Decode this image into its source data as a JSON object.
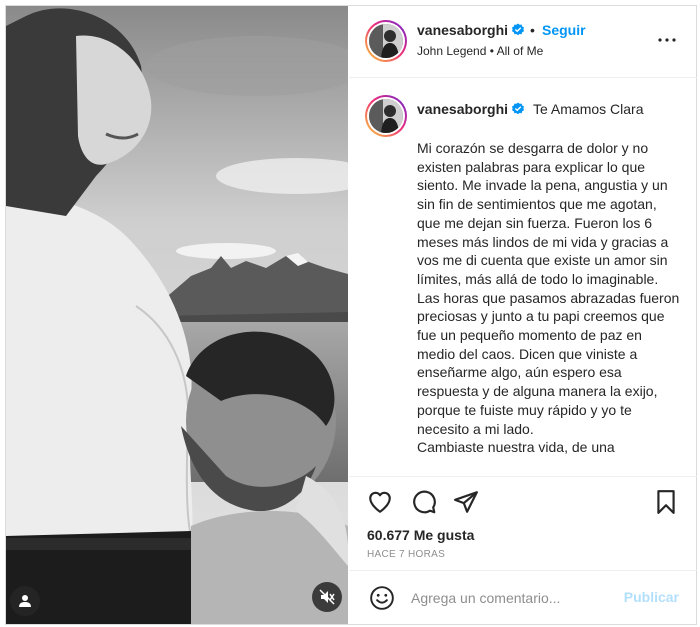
{
  "post": {
    "username": "vanesaborghi",
    "follow_label": "Seguir",
    "separator": "•",
    "audio": "John Legend • All of Me",
    "caption_title": "Te Amamos Clara",
    "caption_body": "Mi corazón se desgarra de dolor y no existen palabras para explicar lo que siento. Me invade la pena, angustia y un sin fin de sentimientos que me agotan, que me dejan sin fuerza. Fueron los 6 meses más lindos de mi vida y gracias a vos me di cuenta que existe un amor sin límites, más allá de todo lo imaginable. Las horas que pasamos abrazadas fueron preciosas y junto a tu papi creemos que fue un pequeño momento de paz en medio del caos. Dicen que viniste a enseñarme algo, aún espero esa respuesta y de alguna manera la exijo, porque te fuiste muy rápido y yo te necesito a mi lado.\nCambiaste nuestra vida, de una",
    "likes": "60.677 Me gusta",
    "time": "HACE 7 HORAS"
  },
  "comment": {
    "placeholder": "Agrega un comentario...",
    "post_label": "Publicar"
  },
  "icons": {
    "like": "heart-icon",
    "comment": "comment-icon",
    "share": "share-icon",
    "save": "bookmark-icon",
    "more": "more-icon",
    "emoji": "emoji-icon",
    "tag": "user-tag-icon",
    "mute": "mute-icon",
    "verified": "verified-badge-icon"
  },
  "colors": {
    "accent": "#0095f6",
    "post_disabled": "#b2dffc",
    "text": "#262626",
    "muted": "#8e8e8e",
    "border": "#dbdbdb"
  }
}
